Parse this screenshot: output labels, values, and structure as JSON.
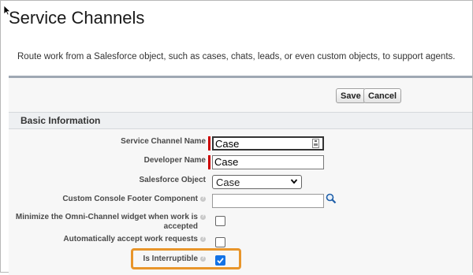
{
  "page": {
    "title": "Service Channels",
    "description": "Route work from a Salesforce object, such as cases, chats, leads, or even custom objects, to support agents."
  },
  "buttons": {
    "save": "Save",
    "cancel": "Cancel"
  },
  "section": {
    "title": "Basic Information"
  },
  "fields": {
    "service_channel_name": {
      "label": "Service Channel Name",
      "value": "Case"
    },
    "developer_name": {
      "label": "Developer Name",
      "value": "Case"
    },
    "salesforce_object": {
      "label": "Salesforce Object",
      "value": "Case"
    },
    "custom_console_footer": {
      "label": "Custom Console Footer Component",
      "value": ""
    },
    "minimize_widget": {
      "label_line1": "Minimize the Omni-Channel widget when work is",
      "label_line2": "accepted",
      "checked": false
    },
    "auto_accept": {
      "label": "Automatically accept work requests",
      "checked": false
    },
    "is_interruptible": {
      "label": "Is Interruptible",
      "checked": true
    }
  },
  "colors": {
    "highlight": "#e8952a",
    "checkbox_checked": "#1473e6",
    "required": "#cc0000",
    "header_bar": "#9fa8b3"
  },
  "icons": {
    "cursor": "mouse-pointer-icon",
    "help": "help-icon",
    "lookup": "magnifier-icon",
    "dropdown": "chevron-down-icon",
    "autofill": "keyboard-icon"
  }
}
